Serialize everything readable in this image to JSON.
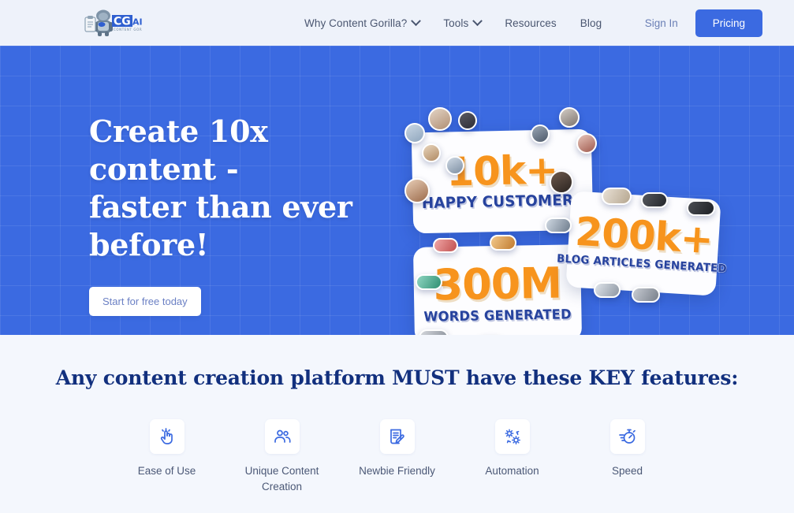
{
  "header": {
    "logo": {
      "name": "content-gorilla-ai-logo",
      "mark_text": "CG",
      "mark_suffix": "AI",
      "subtitle": "CONTENT GORILLA .AI"
    },
    "nav": [
      {
        "label": "Why Content Gorilla?",
        "has_dropdown": true,
        "name": "nav-why-content-gorilla"
      },
      {
        "label": "Tools",
        "has_dropdown": true,
        "name": "nav-tools"
      },
      {
        "label": "Resources",
        "has_dropdown": false,
        "name": "nav-resources"
      },
      {
        "label": "Blog",
        "has_dropdown": false,
        "name": "nav-blog"
      }
    ],
    "sign_in_label": "Sign In",
    "pricing_label": "Pricing",
    "background": "#eef2fa",
    "accent": "#3b6ae1"
  },
  "hero": {
    "title_lines": [
      "Create 10x content -",
      "faster than ever",
      "before!"
    ],
    "title_full": "Create 10x content - faster than ever before!",
    "cta_label": "Start for free today",
    "background": "#3b6ae1",
    "text_color": "#ffffff",
    "stats": [
      {
        "value": "10k+",
        "label": "HAPPY CUSTOMERS",
        "name": "stat-card-happy-customers"
      },
      {
        "value": "200k+",
        "label": "BLOG ARTICLES GENERATED",
        "name": "stat-card-blog-articles"
      },
      {
        "value": "300M",
        "label": "WORDS GENERATED",
        "name": "stat-card-words-generated"
      }
    ],
    "stat_number_color": "#f7941d",
    "stat_label_color": "#27439e"
  },
  "features": {
    "title": "Any content creation platform MUST have these KEY features:",
    "title_color": "#12307e",
    "items": [
      {
        "label": "Ease of Use",
        "icon": "tap-hand-icon",
        "name": "feature-ease-of-use"
      },
      {
        "label": "Unique Content Creation",
        "icon": "people-icon",
        "name": "feature-unique-content-creation"
      },
      {
        "label": "Newbie Friendly",
        "icon": "document-pen-icon",
        "name": "feature-newbie-friendly"
      },
      {
        "label": "Automation",
        "icon": "gears-icon",
        "name": "feature-automation"
      },
      {
        "label": "Speed",
        "icon": "stopwatch-icon",
        "name": "feature-speed"
      }
    ],
    "icon_color": "#3b6ae1"
  }
}
